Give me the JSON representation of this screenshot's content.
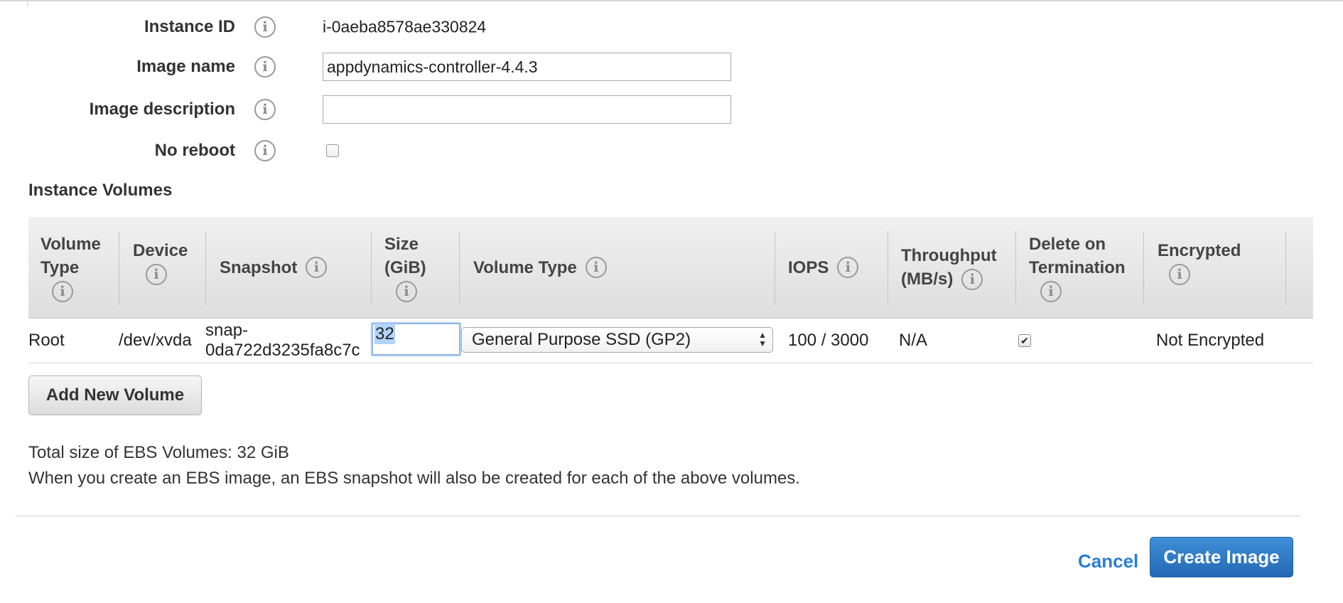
{
  "form": {
    "instance_id": {
      "label": "Instance ID",
      "value": "i-0aeba8578ae330824"
    },
    "image_name": {
      "label": "Image name",
      "value": "appdynamics-controller-4.4.3",
      "placeholder": ""
    },
    "image_description": {
      "label": "Image description",
      "value": "",
      "placeholder": ""
    },
    "no_reboot": {
      "label": "No reboot",
      "checked": false
    }
  },
  "info_icon_glyph": "i",
  "volumes": {
    "title": "Instance Volumes",
    "headers": {
      "volume_type_1": "Volume",
      "volume_type_2": "Type",
      "device": "Device",
      "snapshot": "Snapshot",
      "size_1": "Size",
      "size_2": "(GiB)",
      "volume_type": "Volume Type",
      "iops": "IOPS",
      "throughput_1": "Throughput",
      "throughput_2": "(MB/s)",
      "delete_1": "Delete on",
      "delete_2": "Termination",
      "encrypted": "Encrypted"
    },
    "rows": [
      {
        "volume_type": "Root",
        "device": "/dev/xvda",
        "snapshot_1": "snap-",
        "snapshot_2": "0da722d3235fa8c7c",
        "size": "32",
        "ebs_type": "General Purpose SSD (GP2)",
        "iops": "100 / 3000",
        "throughput": "N/A",
        "delete_on_termination": true,
        "encrypted": "Not Encrypted"
      }
    ],
    "add_button": "Add New Volume"
  },
  "summary": {
    "total": "Total size of EBS Volumes: 32 GiB",
    "note": "When you create an EBS image, an EBS snapshot will also be created for each of the above volumes."
  },
  "footer": {
    "cancel": "Cancel",
    "create": "Create Image"
  },
  "colors": {
    "primary_button": "#2a72c3",
    "link": "#2a7fd0",
    "header_bg": "#e6e6e6"
  }
}
